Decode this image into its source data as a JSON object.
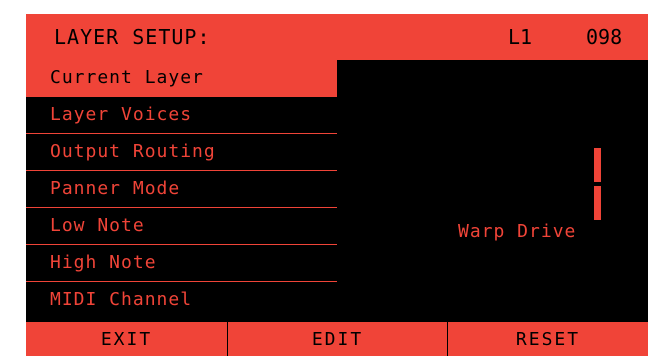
{
  "header": {
    "title": "LAYER SETUP:",
    "layer": "L1",
    "preset": "098"
  },
  "menu": {
    "items": [
      {
        "label": "Current Layer",
        "selected": true
      },
      {
        "label": "Layer Voices",
        "selected": false
      },
      {
        "label": "Output Routing",
        "selected": false
      },
      {
        "label": "Panner Mode",
        "selected": false
      },
      {
        "label": "Low Note",
        "selected": false
      },
      {
        "label": "High Note",
        "selected": false
      },
      {
        "label": "MIDI Channel",
        "selected": false
      }
    ]
  },
  "value": {
    "digit": "1",
    "label": "Warp Drive"
  },
  "footer": {
    "buttons": [
      {
        "label": "EXIT"
      },
      {
        "label": "EDIT"
      },
      {
        "label": "RESET"
      }
    ]
  },
  "colors": {
    "accent": "#f04438",
    "background": "#000000"
  }
}
